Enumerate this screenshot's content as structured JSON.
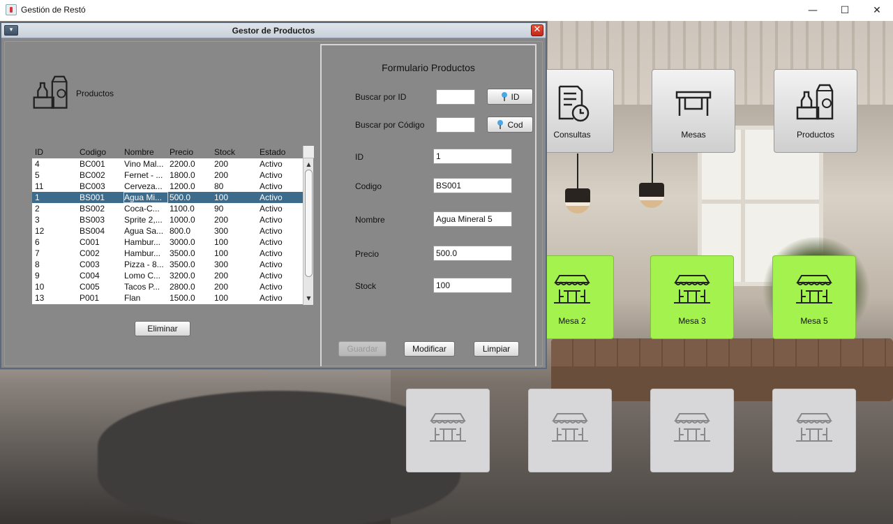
{
  "os_window": {
    "title": "Gestión de Restó",
    "minimize": "—",
    "maximize": "☐",
    "close": "✕"
  },
  "tiles": {
    "top": [
      {
        "label": "Consultas",
        "icon": "document-history-icon"
      },
      {
        "label": "Mesas",
        "icon": "table-icon"
      },
      {
        "label": "Productos",
        "icon": "grocery-products-icon"
      }
    ],
    "mesas": [
      {
        "label": "Mesa 2",
        "status": "active"
      },
      {
        "label": "Mesa 3",
        "status": "active"
      },
      {
        "label": "Mesa 5",
        "status": "active"
      }
    ],
    "empty_count_label": ""
  },
  "internal_frame": {
    "title": "Gestor de Productos",
    "menu_icon": "▾",
    "close_icon": "✕",
    "products_label": "Productos",
    "table": {
      "columns": [
        "ID",
        "Codigo",
        "Nombre",
        "Precio",
        "Stock",
        "Estado"
      ],
      "rows": [
        [
          "4",
          "BC001",
          "Vino Mal...",
          "2200.0",
          "200",
          "Activo"
        ],
        [
          "5",
          "BC002",
          "Fernet - ...",
          "1800.0",
          "200",
          "Activo"
        ],
        [
          "11",
          "BC003",
          "Cerveza...",
          "1200.0",
          "80",
          "Activo"
        ],
        [
          "1",
          "BS001",
          "Agua Mi...",
          "500.0",
          "100",
          "Activo"
        ],
        [
          "2",
          "BS002",
          "Coca-C...",
          "1100.0",
          "90",
          "Activo"
        ],
        [
          "3",
          "BS003",
          "Sprite 2,...",
          "1000.0",
          "200",
          "Activo"
        ],
        [
          "12",
          "BS004",
          "Agua Sa...",
          "800.0",
          "300",
          "Activo"
        ],
        [
          "6",
          "C001",
          "Hambur...",
          "3000.0",
          "100",
          "Activo"
        ],
        [
          "7",
          "C002",
          "Hambur...",
          "3500.0",
          "100",
          "Activo"
        ],
        [
          "8",
          "C003",
          "Pizza - 8...",
          "3500.0",
          "300",
          "Activo"
        ],
        [
          "9",
          "C004",
          "Lomo C...",
          "3200.0",
          "200",
          "Activo"
        ],
        [
          "10",
          "C005",
          "Tacos P...",
          "2800.0",
          "200",
          "Activo"
        ],
        [
          "13",
          "P001",
          "Flan",
          "1500.0",
          "100",
          "Activo"
        ]
      ],
      "selected_row": 3
    },
    "delete_button": "Eliminar",
    "form": {
      "title": "Formulario Productos",
      "search_id_label": "Buscar por ID",
      "search_id_value": "",
      "search_id_button": "ID",
      "search_code_label": "Buscar por Código",
      "search_code_value": "",
      "search_code_button": "Cod",
      "id_label": "ID",
      "id_value": "1",
      "codigo_label": "Codigo",
      "codigo_value": "BS001",
      "nombre_label": "Nombre",
      "nombre_value": "Agua Mineral 5",
      "precio_label": "Precio",
      "precio_value": "500.0",
      "stock_label": "Stock",
      "stock_value": "100",
      "save_button": "Guardar",
      "modify_button": "Modificar",
      "clear_button": "Limpiar"
    }
  },
  "colors": {
    "tile_active": "#a3f24d",
    "frame_bg": "#888888",
    "selected_row": "#3d6b8b"
  }
}
